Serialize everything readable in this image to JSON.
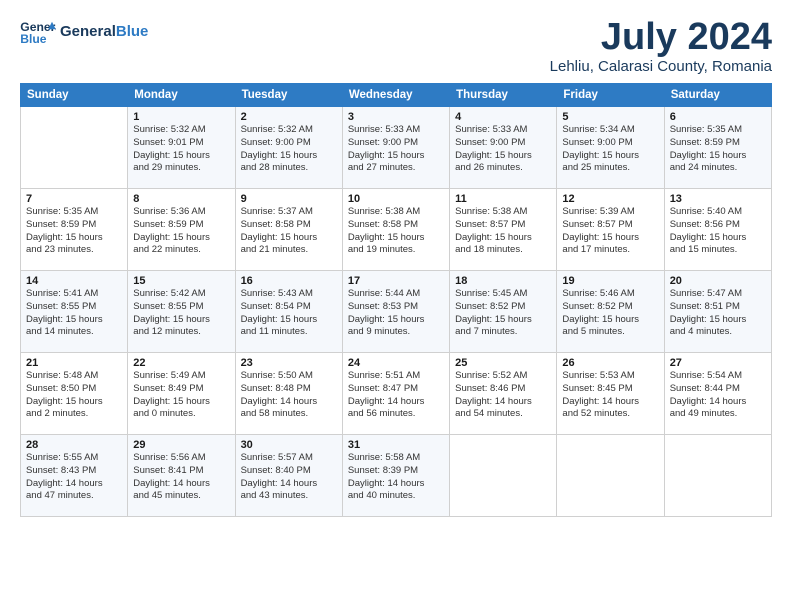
{
  "header": {
    "logo_line1": "General",
    "logo_line2": "Blue",
    "month": "July 2024",
    "location": "Lehliu, Calarasi County, Romania"
  },
  "days_of_week": [
    "Sunday",
    "Monday",
    "Tuesday",
    "Wednesday",
    "Thursday",
    "Friday",
    "Saturday"
  ],
  "weeks": [
    [
      {
        "num": "",
        "info": ""
      },
      {
        "num": "1",
        "info": "Sunrise: 5:32 AM\nSunset: 9:01 PM\nDaylight: 15 hours\nand 29 minutes."
      },
      {
        "num": "2",
        "info": "Sunrise: 5:32 AM\nSunset: 9:00 PM\nDaylight: 15 hours\nand 28 minutes."
      },
      {
        "num": "3",
        "info": "Sunrise: 5:33 AM\nSunset: 9:00 PM\nDaylight: 15 hours\nand 27 minutes."
      },
      {
        "num": "4",
        "info": "Sunrise: 5:33 AM\nSunset: 9:00 PM\nDaylight: 15 hours\nand 26 minutes."
      },
      {
        "num": "5",
        "info": "Sunrise: 5:34 AM\nSunset: 9:00 PM\nDaylight: 15 hours\nand 25 minutes."
      },
      {
        "num": "6",
        "info": "Sunrise: 5:35 AM\nSunset: 8:59 PM\nDaylight: 15 hours\nand 24 minutes."
      }
    ],
    [
      {
        "num": "7",
        "info": "Sunrise: 5:35 AM\nSunset: 8:59 PM\nDaylight: 15 hours\nand 23 minutes."
      },
      {
        "num": "8",
        "info": "Sunrise: 5:36 AM\nSunset: 8:59 PM\nDaylight: 15 hours\nand 22 minutes."
      },
      {
        "num": "9",
        "info": "Sunrise: 5:37 AM\nSunset: 8:58 PM\nDaylight: 15 hours\nand 21 minutes."
      },
      {
        "num": "10",
        "info": "Sunrise: 5:38 AM\nSunset: 8:58 PM\nDaylight: 15 hours\nand 19 minutes."
      },
      {
        "num": "11",
        "info": "Sunrise: 5:38 AM\nSunset: 8:57 PM\nDaylight: 15 hours\nand 18 minutes."
      },
      {
        "num": "12",
        "info": "Sunrise: 5:39 AM\nSunset: 8:57 PM\nDaylight: 15 hours\nand 17 minutes."
      },
      {
        "num": "13",
        "info": "Sunrise: 5:40 AM\nSunset: 8:56 PM\nDaylight: 15 hours\nand 15 minutes."
      }
    ],
    [
      {
        "num": "14",
        "info": "Sunrise: 5:41 AM\nSunset: 8:55 PM\nDaylight: 15 hours\nand 14 minutes."
      },
      {
        "num": "15",
        "info": "Sunrise: 5:42 AM\nSunset: 8:55 PM\nDaylight: 15 hours\nand 12 minutes."
      },
      {
        "num": "16",
        "info": "Sunrise: 5:43 AM\nSunset: 8:54 PM\nDaylight: 15 hours\nand 11 minutes."
      },
      {
        "num": "17",
        "info": "Sunrise: 5:44 AM\nSunset: 8:53 PM\nDaylight: 15 hours\nand 9 minutes."
      },
      {
        "num": "18",
        "info": "Sunrise: 5:45 AM\nSunset: 8:52 PM\nDaylight: 15 hours\nand 7 minutes."
      },
      {
        "num": "19",
        "info": "Sunrise: 5:46 AM\nSunset: 8:52 PM\nDaylight: 15 hours\nand 5 minutes."
      },
      {
        "num": "20",
        "info": "Sunrise: 5:47 AM\nSunset: 8:51 PM\nDaylight: 15 hours\nand 4 minutes."
      }
    ],
    [
      {
        "num": "21",
        "info": "Sunrise: 5:48 AM\nSunset: 8:50 PM\nDaylight: 15 hours\nand 2 minutes."
      },
      {
        "num": "22",
        "info": "Sunrise: 5:49 AM\nSunset: 8:49 PM\nDaylight: 15 hours\nand 0 minutes."
      },
      {
        "num": "23",
        "info": "Sunrise: 5:50 AM\nSunset: 8:48 PM\nDaylight: 14 hours\nand 58 minutes."
      },
      {
        "num": "24",
        "info": "Sunrise: 5:51 AM\nSunset: 8:47 PM\nDaylight: 14 hours\nand 56 minutes."
      },
      {
        "num": "25",
        "info": "Sunrise: 5:52 AM\nSunset: 8:46 PM\nDaylight: 14 hours\nand 54 minutes."
      },
      {
        "num": "26",
        "info": "Sunrise: 5:53 AM\nSunset: 8:45 PM\nDaylight: 14 hours\nand 52 minutes."
      },
      {
        "num": "27",
        "info": "Sunrise: 5:54 AM\nSunset: 8:44 PM\nDaylight: 14 hours\nand 49 minutes."
      }
    ],
    [
      {
        "num": "28",
        "info": "Sunrise: 5:55 AM\nSunset: 8:43 PM\nDaylight: 14 hours\nand 47 minutes."
      },
      {
        "num": "29",
        "info": "Sunrise: 5:56 AM\nSunset: 8:41 PM\nDaylight: 14 hours\nand 45 minutes."
      },
      {
        "num": "30",
        "info": "Sunrise: 5:57 AM\nSunset: 8:40 PM\nDaylight: 14 hours\nand 43 minutes."
      },
      {
        "num": "31",
        "info": "Sunrise: 5:58 AM\nSunset: 8:39 PM\nDaylight: 14 hours\nand 40 minutes."
      },
      {
        "num": "",
        "info": ""
      },
      {
        "num": "",
        "info": ""
      },
      {
        "num": "",
        "info": ""
      }
    ]
  ]
}
